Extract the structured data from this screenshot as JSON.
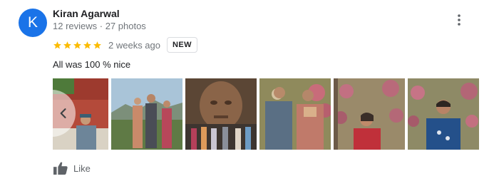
{
  "reviewer": {
    "initial": "K",
    "name": "Kiran Agarwal",
    "meta": "12 reviews · 27 photos",
    "avatar_color": "#1a73e8"
  },
  "review": {
    "rating": 5,
    "time_ago": "2 weeks ago",
    "badge": "NEW",
    "text": "All was 100 % nice",
    "star_color": "#fbbc04"
  },
  "actions": {
    "like_label": "Like"
  },
  "icons": {
    "more": "more-vert-icon",
    "prev": "chevron-left-icon",
    "like": "thumbs-up-icon",
    "star": "star-icon"
  }
}
